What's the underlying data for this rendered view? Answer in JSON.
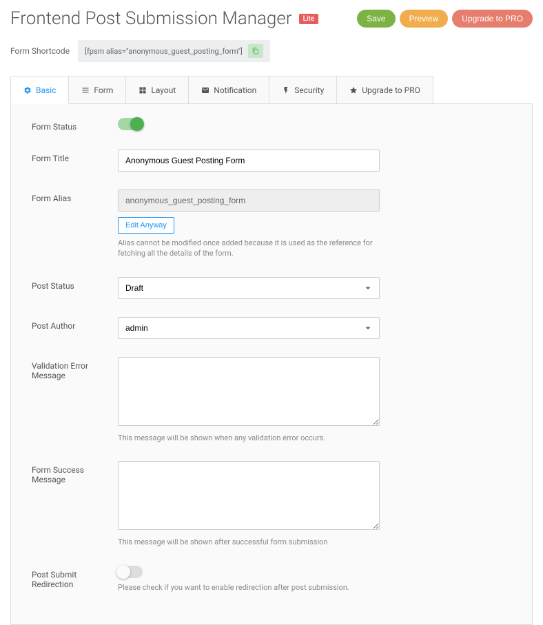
{
  "header": {
    "title": "Frontend Post Submission Manager",
    "lite_badge": "Lite",
    "save_label": "Save",
    "preview_label": "Preview",
    "upgrade_label": "Upgrade to PRO"
  },
  "shortcode": {
    "label": "Form Shortcode",
    "value": "[fpsm alias=\"anonymous_guest_posting_form\"]"
  },
  "tabs": {
    "basic": "Basic",
    "form": "Form",
    "layout": "Layout",
    "notification": "Notification",
    "security": "Security",
    "upgrade": "Upgrade to PRO"
  },
  "fields": {
    "form_status": {
      "label": "Form Status"
    },
    "form_title": {
      "label": "Form Title",
      "value": "Anonymous Guest Posting Form"
    },
    "form_alias": {
      "label": "Form Alias",
      "value": "anonymous_guest_posting_form",
      "edit_anyway": "Edit Anyway",
      "help": "Alias cannot be modified once added because it is used as the reference for fetching all the details of the form."
    },
    "post_status": {
      "label": "Post Status",
      "value": "Draft"
    },
    "post_author": {
      "label": "Post Author",
      "value": "admin"
    },
    "validation_error": {
      "label": "Validation Error Message",
      "value": "",
      "help": "This message will be shown when any validation error occurs."
    },
    "success_message": {
      "label": "Form Success Message",
      "value": "",
      "help": "This message will be shown after successful form submission"
    },
    "post_redirect": {
      "label": "Post Submit Redirection",
      "help": "Please check if you want to enable redirection after post submission."
    }
  }
}
